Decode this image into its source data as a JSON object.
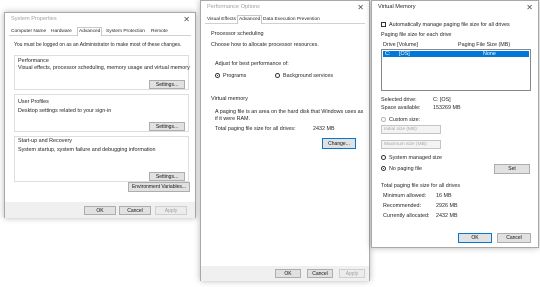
{
  "system_properties": {
    "title": "System Properties",
    "tabs": [
      "Computer Name",
      "Hardware",
      "Advanced",
      "System Protection",
      "Remote"
    ],
    "admin_note": "You must be logged on as an Administrator to make most of these changes.",
    "performance": {
      "header": "Performance",
      "desc": "Visual effects, processor scheduling, memory usage and virtual memory",
      "button": "Settings..."
    },
    "user_profiles": {
      "header": "User Profiles",
      "desc": "Desktop settings related to your sign-in",
      "button": "Settings..."
    },
    "startup_recovery": {
      "header": "Start-up and Recovery",
      "desc": "System startup, system failure and debugging information",
      "button": "Settings..."
    },
    "env_button": "Environment Variables...",
    "ok": "OK",
    "cancel": "Cancel",
    "apply": "Apply"
  },
  "performance_options": {
    "title": "Performance Options",
    "tabs": [
      "Visual Effects",
      "Advanced",
      "Data Execution Prevention"
    ],
    "processor_header": "Processor scheduling",
    "processor_desc": "Choose how to allocate processor resources.",
    "adjust_label": "Adjust for best performance of:",
    "opt_programs": "Programs",
    "opt_background": "Background services",
    "vm_header": "Virtual memory",
    "vm_desc": "A paging file is an area on the hard disk that Windows uses as if it were RAM.",
    "vm_total_label": "Total paging file size for all drives:",
    "vm_total_value": "2432 MB",
    "change_button": "Change...",
    "ok": "OK",
    "cancel": "Cancel",
    "apply": "Apply"
  },
  "virtual_memory": {
    "title": "Virtual Memory",
    "auto_manage": "Automatically manage paging file size for all drives",
    "paging_each_drive": "Paging file size for each drive",
    "col_drive": "Drive  [Volume]",
    "col_size": "Paging File Size (MB)",
    "drive_row": {
      "drive": "C:",
      "volume": "[OS]",
      "size": "None"
    },
    "selected_drive_label": "Selected drive:",
    "selected_drive_value": "C:  [OS]",
    "space_available_label": "Space available:",
    "space_available_value": "153269 MB",
    "custom_size": "Custom size:",
    "initial_size": "Initial size (MB):",
    "maximum_size": "Maximum size (MB):",
    "system_managed": "System managed size",
    "no_paging": "No paging file",
    "set_button": "Set",
    "total_header": "Total paging file size for all drives",
    "min_allowed_label": "Minimum allowed:",
    "min_allowed_value": "16 MB",
    "recommended_label": "Recommended:",
    "recommended_value": "2926 MB",
    "currently_allocated_label": "Currently allocated:",
    "currently_allocated_value": "2432 MB",
    "ok": "OK",
    "cancel": "Cancel"
  }
}
